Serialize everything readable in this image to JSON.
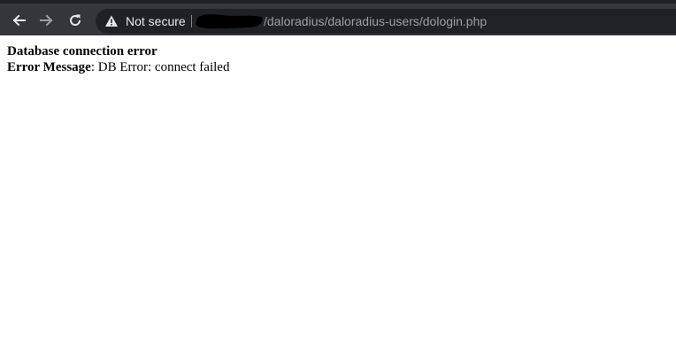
{
  "browser": {
    "security_label": "Not secure",
    "url_path": "/daloradius/daloradius-users/dologin.php",
    "colors": {
      "toolbar": "#35363a",
      "omnibox": "#202124",
      "url_text": "#9aa0a6",
      "icon": "#e8eaed",
      "icon_disabled": "#9aa0a6"
    },
    "icons": [
      "back-arrow-icon",
      "forward-arrow-icon",
      "reload-icon",
      "warning-triangle-icon"
    ]
  },
  "page": {
    "error_title": "Database connection error",
    "error_label": "Error Message",
    "error_separator": ": ",
    "error_text": "DB Error: connect failed"
  }
}
